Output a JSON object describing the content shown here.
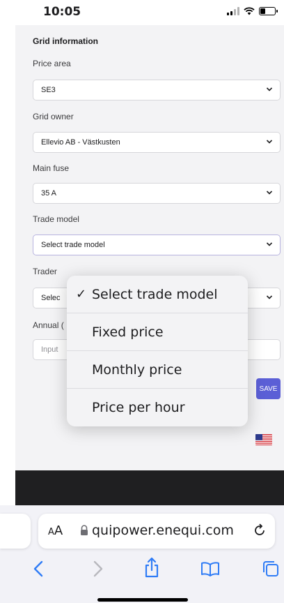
{
  "status_bar": {
    "time": "10:05"
  },
  "form": {
    "section_title": "Grid information",
    "fields": [
      {
        "label": "Price area",
        "value": "SE3"
      },
      {
        "label": "Grid owner",
        "value": "Ellevio AB - Västkusten"
      },
      {
        "label": "Main fuse",
        "value": "35 A"
      },
      {
        "label": "Trade model",
        "value": "Select trade model"
      },
      {
        "label": "Trader",
        "value": "Selec"
      },
      {
        "label": "Annual (",
        "placeholder": "Input"
      }
    ],
    "save_label": "SAVE"
  },
  "dropdown": {
    "options": [
      {
        "label": "Select trade model",
        "selected": true
      },
      {
        "label": "Fixed price",
        "selected": false
      },
      {
        "label": "Monthly price",
        "selected": false
      },
      {
        "label": "Price per hour",
        "selected": false
      }
    ],
    "check_mark": "✓"
  },
  "browser": {
    "aa_large": "A",
    "aa_small": "A",
    "url": "quipower.enequi.com"
  },
  "colors": {
    "accent": "#5b5fd6",
    "active_border": "#b7b3df",
    "content_bg": "#f3f3f5"
  },
  "icons": [
    "wifi-icon",
    "battery-icon",
    "chevron-down-icon",
    "us-flag-icon",
    "lock-icon",
    "reload-icon",
    "back-icon",
    "forward-icon",
    "share-icon",
    "bookmarks-icon",
    "tabs-icon"
  ]
}
